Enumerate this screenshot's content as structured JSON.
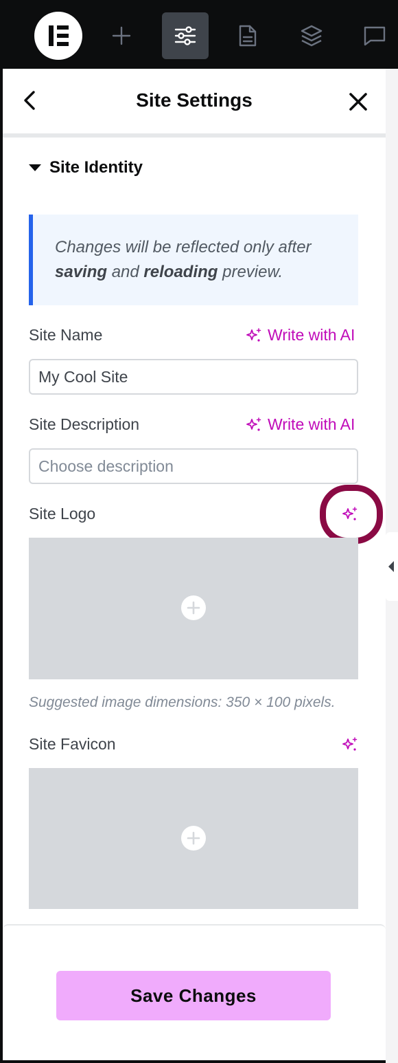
{
  "topbar": {
    "icons": [
      "elementor-logo-icon",
      "add-element-icon",
      "site-settings-icon",
      "page-settings-icon",
      "structure-layers-icon",
      "comments-icon"
    ]
  },
  "panel": {
    "title": "Site Settings",
    "back_icon": "chevron-left-icon",
    "close_icon": "close-icon"
  },
  "section": {
    "title": "Site Identity",
    "notice": {
      "part1": "Changes will be reflected only after ",
      "bold1": "saving",
      "part2": " and ",
      "bold2": "reloading",
      "part3": " preview."
    }
  },
  "fields": {
    "site_name": {
      "label": "Site Name",
      "ai_label": "Write with AI",
      "value": "My Cool Site"
    },
    "site_description": {
      "label": "Site Description",
      "ai_label": "Write with AI",
      "placeholder": "Choose description"
    },
    "site_logo": {
      "label": "Site Logo",
      "hint": "Suggested image dimensions: 350 × 100 pixels."
    },
    "site_favicon": {
      "label": "Site Favicon"
    }
  },
  "footer": {
    "save_label": "Save Changes"
  },
  "colors": {
    "ai_accent": "#c00bb9",
    "notice_border": "#2563eb",
    "save_button": "#f0abfc",
    "highlight_ring": "#8a0a44"
  }
}
